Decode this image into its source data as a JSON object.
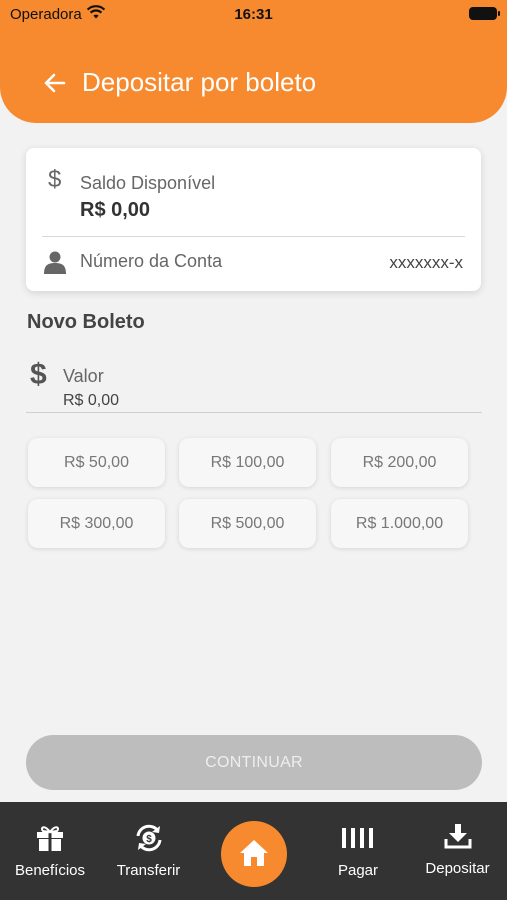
{
  "status_bar": {
    "carrier": "Operadora",
    "time": "16:31"
  },
  "header": {
    "title": "Depositar por boleto",
    "back_icon": "arrow-left-icon"
  },
  "account_card": {
    "saldo_label": "Saldo Disponível",
    "saldo_value": "R$ 0,00",
    "conta_label": "Número da Conta",
    "conta_value": "xxxxxxx-x"
  },
  "section_title": "Novo Boleto",
  "valor": {
    "label": "Valor",
    "value": "R$ 0,00"
  },
  "amount_chips": [
    "R$ 50,00",
    "R$ 100,00",
    "R$ 200,00",
    "R$ 300,00",
    "R$ 500,00",
    "R$ 1.000,00"
  ],
  "continue_label": "CONTINUAR",
  "tabbar": {
    "items": [
      {
        "label": "Benefícios",
        "icon": "gift-icon"
      },
      {
        "label": "Transferir",
        "icon": "transfer-icon"
      },
      {
        "label": "",
        "icon": "home-icon"
      },
      {
        "label": "Pagar",
        "icon": "barcode-icon"
      },
      {
        "label": "Depositar",
        "icon": "download-icon"
      }
    ]
  },
  "colors": {
    "primary": "#f78a2e",
    "tabbar": "#333333",
    "background": "#f2f2f2",
    "disabled_button": "#bdbdbd"
  }
}
